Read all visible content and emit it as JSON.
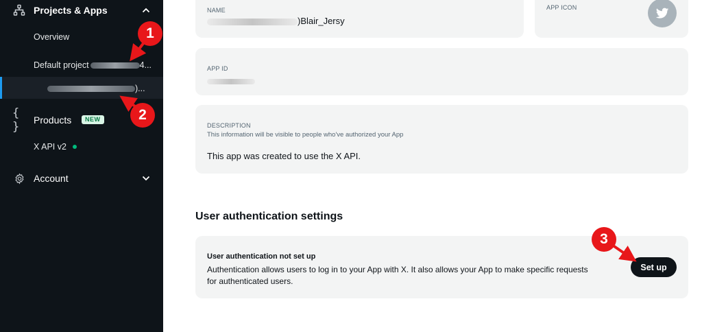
{
  "sidebar": {
    "projects_label": "Projects & Apps",
    "overview_label": "Overview",
    "default_project_prefix": "Default project",
    "default_project_suffix": "4...",
    "app_suffix": ")...",
    "products_label": "Products",
    "new_badge": "NEW",
    "xapi_label": "X API v2",
    "account_label": "Account"
  },
  "app_details": {
    "name_label": "NAME",
    "name_value_suffix": ")Blair_Jersy",
    "app_icon_label": "APP ICON",
    "app_id_label": "APP ID",
    "description_label": "DESCRIPTION",
    "description_hint": "This information will be visible to people who've authorized your App",
    "description_value": "This app was created to use the X API."
  },
  "user_auth": {
    "section_title": "User authentication settings",
    "status_title": "User authentication not set up",
    "status_line1": "Authentication allows users to log in to your App with X. It also allows your App to make specific requests",
    "status_line2": "for authenticated users.",
    "setup_label": "Set up"
  },
  "annotations": {
    "marker_1": "1",
    "marker_2": "2",
    "marker_3": "3"
  },
  "colors": {
    "sidebar_bg": "#0e1419",
    "accent": "#1d9bf0",
    "marker": "#e8171a",
    "card_bg": "#f3f4f4",
    "button_bg": "#0f1419"
  }
}
